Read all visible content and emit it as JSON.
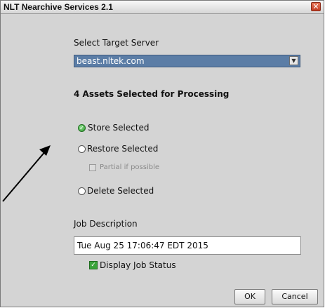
{
  "window": {
    "title": "NLT Nearchive Services 2.1",
    "close_glyph": "✕"
  },
  "server": {
    "label": "Select Target Server",
    "selected": "beast.nltek.com",
    "arrow_glyph": "▼"
  },
  "assets_heading": "4 Assets Selected for Processing",
  "options": {
    "store": "Store Selected",
    "restore": "Restore Selected",
    "partial": "Partial if possible",
    "delete": "Delete Selected"
  },
  "job": {
    "label": "Job Description",
    "value": "Tue Aug 25 17:06:47 EDT 2015",
    "display_status": "Display Job Status"
  },
  "buttons": {
    "ok": "OK",
    "cancel": "Cancel"
  },
  "colors": {
    "selected_option": "#2f9a2f",
    "select_background": "#5b7da6"
  },
  "icons": {
    "check_glyph": "✓"
  }
}
